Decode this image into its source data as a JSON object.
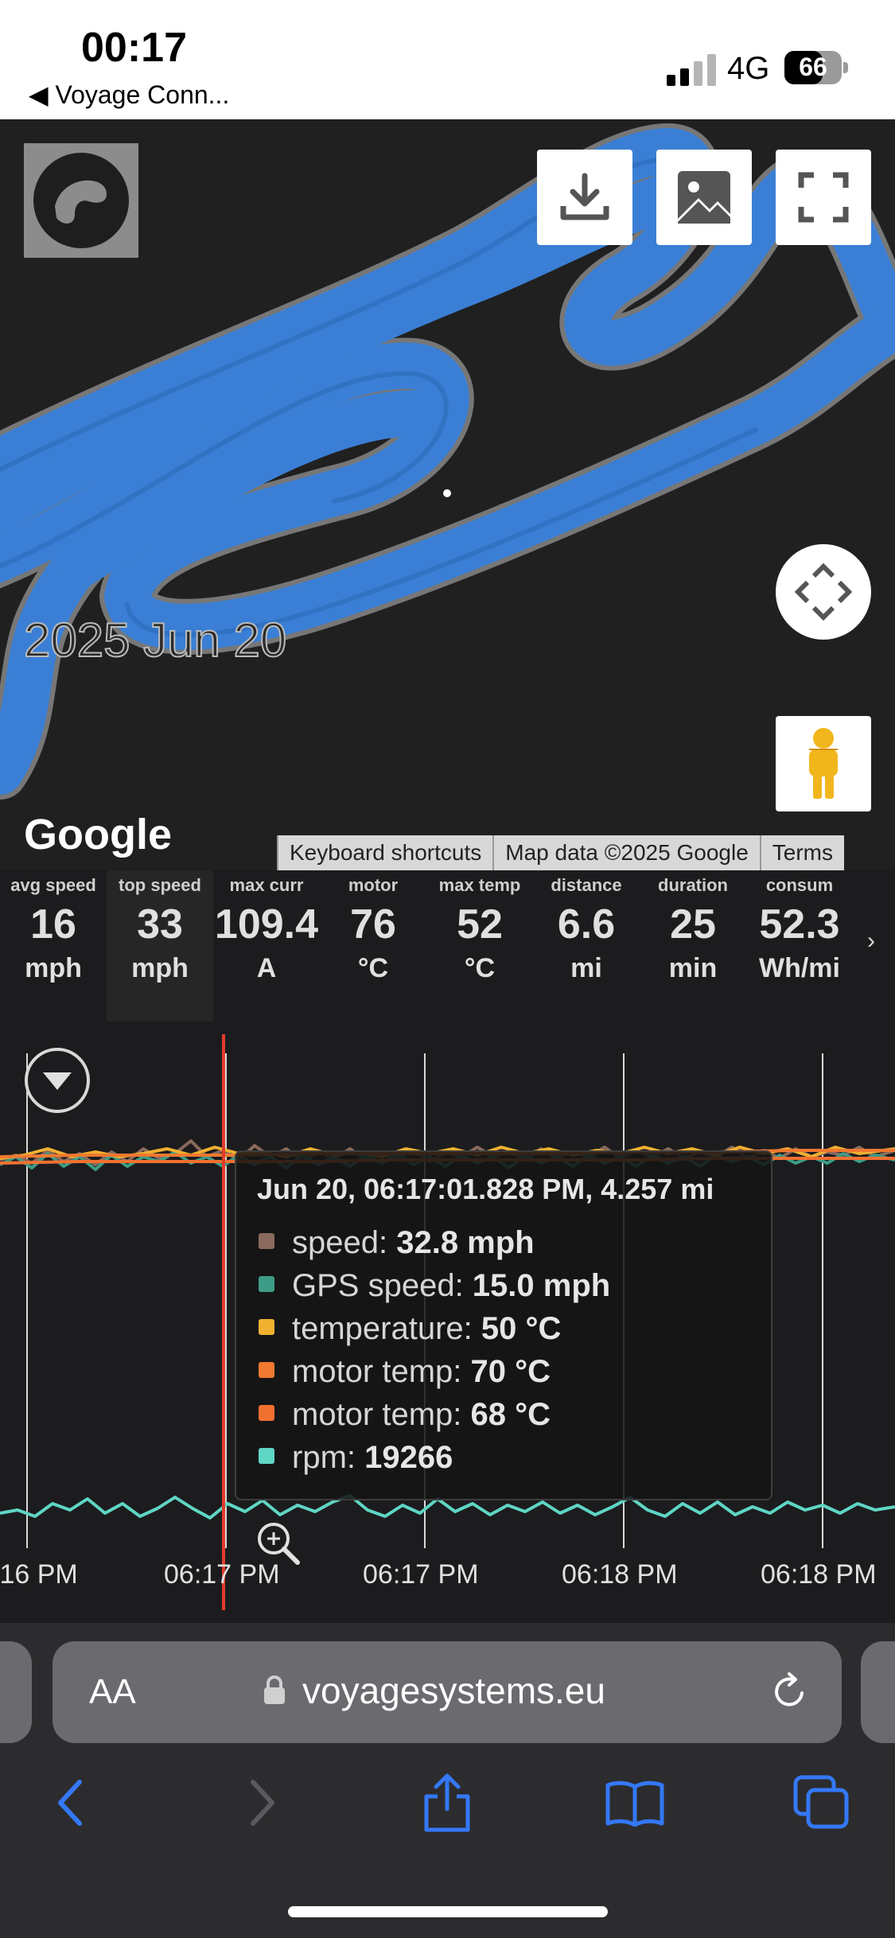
{
  "status": {
    "time": "00:17",
    "back_app": "◀ Voyage Conn...",
    "network": "4G",
    "battery": "66",
    "battery_level": 66
  },
  "map": {
    "date_overlay": "2025 Jun 20",
    "google_logo": "Google",
    "attribution": [
      "Keyboard shortcuts",
      "Map data ©2025 Google",
      "Terms"
    ],
    "track_color": "#3a7fd5"
  },
  "stats": [
    {
      "label": "avg speed",
      "value": "16",
      "unit": "mph"
    },
    {
      "label": "top speed",
      "value": "33",
      "unit": "mph"
    },
    {
      "label": "max curr",
      "value": "109.4",
      "unit": "A"
    },
    {
      "label": "motor",
      "value": "76",
      "unit": "°C"
    },
    {
      "label": "max temp",
      "value": "52",
      "unit": "°C"
    },
    {
      "label": "distance",
      "value": "6.6",
      "unit": "mi"
    },
    {
      "label": "duration",
      "value": "25",
      "unit": "min"
    },
    {
      "label": "consum",
      "value": "52.3",
      "unit": "Wh/mi"
    }
  ],
  "chart": {
    "x_ticks": [
      ":16 PM",
      "06:17 PM",
      "06:17 PM",
      "06:18 PM",
      "06:18 PM"
    ],
    "tooltip": {
      "title": "Jun 20, 06:17:01.828 PM, 4.257 mi",
      "rows": [
        {
          "name": "speed: ",
          "value": "32.8 mph",
          "color": "#8a6a5c"
        },
        {
          "name": "GPS speed: ",
          "value": "15.0 mph",
          "color": "#3d9c86"
        },
        {
          "name": "temperature: ",
          "value": "50 °C",
          "color": "#f0b030"
        },
        {
          "name": "motor temp: ",
          "value": "70 °C",
          "color": "#f07830"
        },
        {
          "name": "motor temp: ",
          "value": "68 °C",
          "color": "#f07030"
        },
        {
          "name": "rpm: ",
          "value": "19266",
          "color": "#5fd6c4"
        }
      ]
    },
    "cursor_color": "#e03c2c"
  },
  "browser": {
    "aa": "AA",
    "url": "voyagesystems.eu",
    "accent": "#3478f6"
  }
}
